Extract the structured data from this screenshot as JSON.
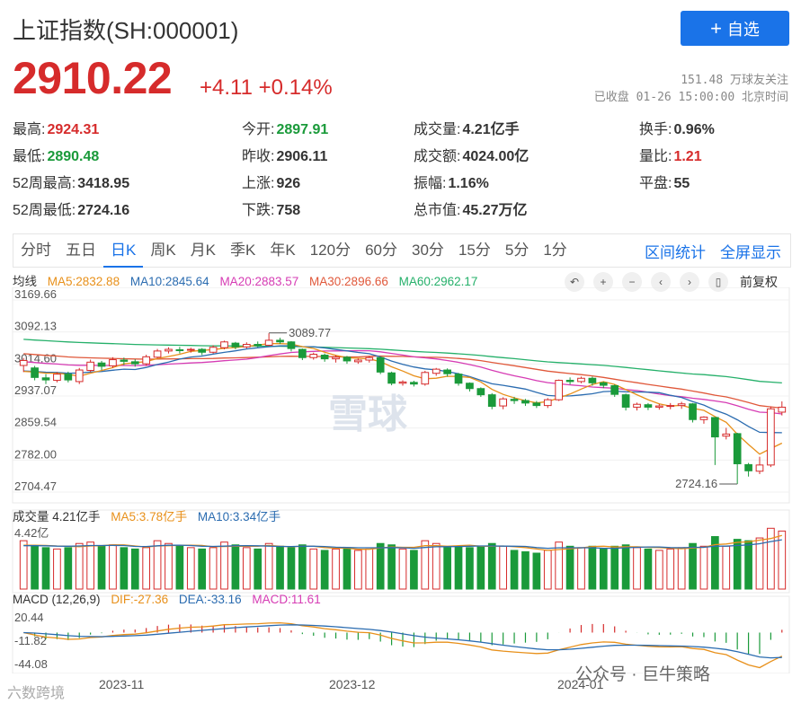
{
  "header": {
    "title": "上证指数(SH:000001)",
    "add_label": "自选",
    "price": "2910.22",
    "change": "+4.11 +0.14%",
    "followers": "151.48 万球友关注",
    "closed": "已收盘 01-26 15:00:00 北京时间"
  },
  "stats": [
    {
      "label": "最高:",
      "value": "2924.31",
      "color": "#d62b2b"
    },
    {
      "label": "今开:",
      "value": "2897.91",
      "color": "#1a9a3a"
    },
    {
      "label": "成交量:",
      "value": "4.21亿手",
      "color": "#333333"
    },
    {
      "label": "换手:",
      "value": "0.96%",
      "color": "#333333"
    },
    {
      "label": "最低:",
      "value": "2890.48",
      "color": "#1a9a3a"
    },
    {
      "label": "昨收:",
      "value": "2906.11",
      "color": "#333333"
    },
    {
      "label": "成交额:",
      "value": "4024.00亿",
      "color": "#333333"
    },
    {
      "label": "量比:",
      "value": "1.21",
      "color": "#d62b2b"
    },
    {
      "label": "52周最高:",
      "value": "3418.95",
      "color": "#333333"
    },
    {
      "label": "上涨:",
      "value": "926",
      "color": "#333333"
    },
    {
      "label": "振幅:",
      "value": "1.16%",
      "color": "#333333"
    },
    {
      "label": "平盘:",
      "value": "55",
      "color": "#333333"
    },
    {
      "label": "52周最低:",
      "value": "2724.16",
      "color": "#333333"
    },
    {
      "label": "下跌:",
      "value": "758",
      "color": "#333333"
    },
    {
      "label": "总市值:",
      "value": "45.27万亿",
      "color": "#333333"
    }
  ],
  "tabs": [
    "分时",
    "五日",
    "日K",
    "周K",
    "月K",
    "季K",
    "年K",
    "120分",
    "60分",
    "30分",
    "15分",
    "5分",
    "1分"
  ],
  "active_tab": "日K",
  "tabs_right": [
    "区间统计",
    "全屏显示"
  ],
  "ma_legend": {
    "label": "均线",
    "ma5": "MA5:2832.88",
    "ma10": "MA10:2845.64",
    "ma20": "MA20:2883.57",
    "ma30": "MA30:2896.66",
    "ma60": "MA60:2962.17"
  },
  "restore_label": "前复权",
  "volume_legend": {
    "label": "成交量 4.21亿手",
    "ma5": "MA5:3.78亿手",
    "ma10": "MA10:3.34亿手"
  },
  "macd_legend": {
    "label": "MACD (12,26,9)",
    "dif": "DIF:-27.36",
    "dea": "DEA:-33.16",
    "macd": "MACD:11.61"
  },
  "dates": [
    "2023-11",
    "2023-12",
    "2024-01"
  ],
  "watermark": "公众号 · 巨牛策略",
  "watermark2": "六数跨境",
  "logo_watermark": "雪球",
  "colors": {
    "up": "#d62b2b",
    "down": "#1a9a3a",
    "accent": "#1a73e8"
  },
  "chart_data": {
    "type": "candlestick",
    "price_axis": {
      "ticks": [
        "3169.66",
        "3092.13",
        "3014.60",
        "2937.07",
        "2859.54",
        "2782.00",
        "2704.47"
      ],
      "ylim": [
        2704.47,
        3169.66
      ]
    },
    "annotations": [
      {
        "label": "3089.77",
        "value": 3089.77
      },
      {
        "label": "2724.16",
        "value": 2724.16
      }
    ],
    "volume_axis": {
      "ticks": [
        "4.42亿"
      ],
      "max": 4.42
    },
    "macd_axis": {
      "ticks": [
        "20.44",
        "-11.82",
        "-44.08"
      ],
      "ylim": [
        -44.08,
        20.44
      ]
    },
    "candles": [
      [
        3011,
        3023,
        2995,
        3029
      ],
      [
        3005,
        2982,
        2975,
        3010
      ],
      [
        2981,
        2976,
        2966,
        2990
      ],
      [
        2975,
        2990,
        2970,
        2995
      ],
      [
        2990,
        2976,
        2970,
        2996
      ],
      [
        2972,
        3000,
        2966,
        3005
      ],
      [
        2999,
        3019,
        2995,
        3025
      ],
      [
        3017,
        3009,
        3000,
        3022
      ],
      [
        3010,
        3025,
        3005,
        3031
      ],
      [
        3024,
        3021,
        3012,
        3030
      ],
      [
        3020,
        3015,
        3008,
        3026
      ],
      [
        3015,
        3032,
        3010,
        3037
      ],
      [
        3031,
        3046,
        3028,
        3051
      ],
      [
        3046,
        3050,
        3040,
        3055
      ],
      [
        3049,
        3048,
        3040,
        3056
      ],
      [
        3048,
        3050,
        3042,
        3054
      ],
      [
        3050,
        3043,
        3036,
        3053
      ],
      [
        3043,
        3055,
        3040,
        3060
      ],
      [
        3054,
        3068,
        3050,
        3071
      ],
      [
        3065,
        3056,
        3050,
        3068
      ],
      [
        3056,
        3062,
        3052,
        3067
      ],
      [
        3062,
        3061,
        3055,
        3069
      ],
      [
        3060,
        3072,
        3058,
        3089
      ],
      [
        3072,
        3068,
        3063,
        3078
      ],
      [
        3068,
        3052,
        3045,
        3070
      ],
      [
        3050,
        3030,
        3024,
        3052
      ],
      [
        3030,
        3038,
        3025,
        3042
      ],
      [
        3036,
        3027,
        3020,
        3040
      ],
      [
        3027,
        3031,
        3018,
        3036
      ],
      [
        3031,
        3022,
        3015,
        3034
      ],
      [
        3020,
        3024,
        3015,
        3028
      ],
      [
        3024,
        3030,
        3018,
        3034
      ],
      [
        3030,
        2995,
        2990,
        3032
      ],
      [
        2993,
        2968,
        2963,
        2996
      ],
      [
        2968,
        2971,
        2962,
        2975
      ],
      [
        2970,
        2966,
        2960,
        2974
      ],
      [
        2966,
        2994,
        2962,
        2998
      ],
      [
        2992,
        3002,
        2986,
        3005
      ],
      [
        3000,
        2991,
        2984,
        3004
      ],
      [
        2990,
        2968,
        2962,
        2993
      ],
      [
        2968,
        2955,
        2948,
        2970
      ],
      [
        2955,
        2940,
        2935,
        2958
      ],
      [
        2940,
        2912,
        2905,
        2944
      ],
      [
        2913,
        2930,
        2905,
        2934
      ],
      [
        2929,
        2926,
        2918,
        2935
      ],
      [
        2926,
        2920,
        2913,
        2930
      ],
      [
        2920,
        2914,
        2908,
        2925
      ],
      [
        2914,
        2928,
        2908,
        2932
      ],
      [
        2928,
        2975,
        2925,
        2977
      ],
      [
        2975,
        2972,
        2965,
        2982
      ],
      [
        2972,
        2980,
        2968,
        2984
      ],
      [
        2980,
        2969,
        2962,
        2984
      ],
      [
        2969,
        2963,
        2956,
        2972
      ],
      [
        2962,
        2941,
        2935,
        2965
      ],
      [
        2940,
        2910,
        2902,
        2943
      ],
      [
        2910,
        2917,
        2902,
        2921
      ],
      [
        2916,
        2910,
        2903,
        2920
      ],
      [
        2910,
        2913,
        2904,
        2918
      ],
      [
        2912,
        2914,
        2905,
        2920
      ],
      [
        2914,
        2918,
        2906,
        2923
      ],
      [
        2918,
        2880,
        2873,
        2920
      ],
      [
        2880,
        2886,
        2870,
        2888
      ],
      [
        2885,
        2838,
        2770,
        2886
      ],
      [
        2840,
        2845,
        2832,
        2860
      ],
      [
        2846,
        2773,
        2724,
        2848
      ],
      [
        2771,
        2756,
        2742,
        2775
      ],
      [
        2755,
        2770,
        2748,
        2790
      ],
      [
        2770,
        2906,
        2765,
        2912
      ],
      [
        2898,
        2910,
        2890,
        2924
      ]
    ],
    "volumes": [
      3.5,
      3.1,
      3.0,
      2.9,
      3.0,
      3.3,
      3.4,
      3.1,
      3.2,
      3.0,
      2.9,
      3.0,
      3.5,
      3.3,
      3.1,
      3.0,
      2.9,
      3.0,
      3.4,
      3.2,
      3.0,
      2.9,
      3.3,
      3.1,
      3.0,
      3.2,
      2.9,
      2.8,
      2.9,
      3.0,
      2.8,
      2.9,
      3.3,
      3.2,
      2.9,
      2.8,
      3.5,
      3.3,
      3.0,
      3.1,
      3.0,
      3.1,
      3.3,
      3.1,
      2.8,
      2.7,
      2.6,
      2.8,
      3.4,
      3.1,
      3.0,
      3.1,
      2.9,
      3.1,
      3.2,
      3.0,
      2.9,
      2.8,
      2.9,
      3.0,
      3.3,
      3.1,
      3.8,
      3.1,
      3.6,
      3.5,
      3.7,
      4.4,
      4.2
    ]
  }
}
